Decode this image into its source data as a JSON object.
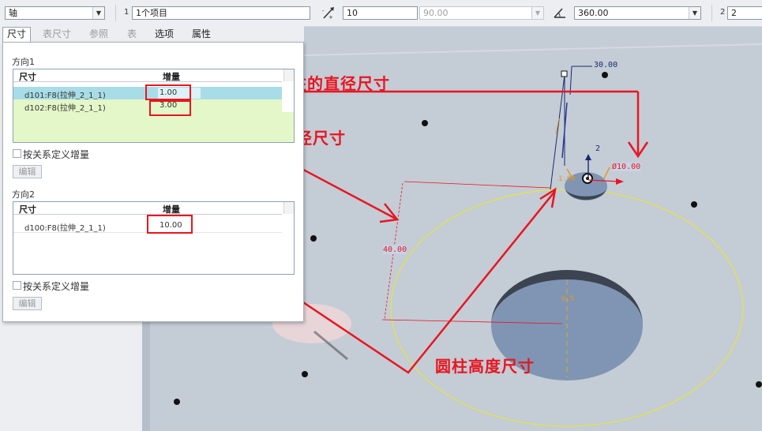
{
  "toolbar": {
    "type_value": "轴",
    "ref_count_label": "1",
    "ref_value": "1个项目",
    "incr1_value": "10",
    "incr2_value": "90.00",
    "angle_value": "360.00",
    "count_label": "2",
    "count_value": "2"
  },
  "tabs": [
    {
      "label": "尺寸"
    },
    {
      "label": "表尺寸"
    },
    {
      "label": "参照"
    },
    {
      "label": "表"
    },
    {
      "label": "选项"
    },
    {
      "label": "属性"
    }
  ],
  "direction1": {
    "title": "方向1",
    "col_dim": "尺寸",
    "col_incr": "增量",
    "rows": [
      {
        "dim": "d101:F8(拉伸_2_1_1)",
        "incr": "1.00"
      },
      {
        "dim": "d102:F8(拉伸_2_1_1)",
        "incr": "3.00"
      }
    ],
    "checkbox_label": "按关系定义增量",
    "edit_label": "编辑"
  },
  "direction2": {
    "title": "方向2",
    "col_dim": "尺寸",
    "col_incr": "增量",
    "rows": [
      {
        "dim": "d100:F8(拉伸_2_1_1)",
        "incr": "10.00"
      }
    ],
    "checkbox_label": "按关系定义增量",
    "edit_label": "编辑"
  },
  "annotations": {
    "diameter": "圆柱的直径尺寸",
    "radius": "半径尺寸",
    "height": "圆柱高度尺寸"
  },
  "model_dims": {
    "d30": "30.00",
    "d2": "2",
    "dia": "Ø10.00",
    "d40": "40.00",
    "small": "1.00",
    "hole": "0.5"
  },
  "colors": {
    "accent_red": "#e8161f",
    "selection_cyan": "#a8dde8",
    "row_green": "#e4f7c8",
    "viewport": "#c4ccd6",
    "circle_yellow": "#e6e63a"
  }
}
